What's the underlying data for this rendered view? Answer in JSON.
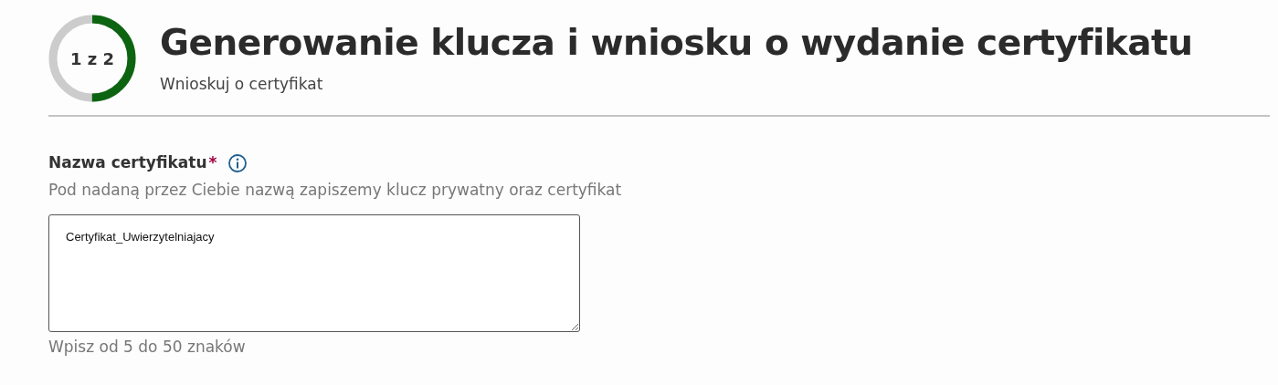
{
  "progress": {
    "label": "1 z 2",
    "level": 0.5
  },
  "title": "Generowanie klucza i wniosku o wydanie certyfikatu",
  "subtitle": "Wnioskuj o certyfikat",
  "field": {
    "label": "Nazwa certyfikatu",
    "required_marker": "*",
    "description": "Pod nadaną przez Ciebie nazwą zapiszemy klucz prywatny oraz certyfikat",
    "value": "Certyfikat_Uwierzytelniajacy",
    "hint": "Wpisz od 5 do 50 znaków"
  }
}
